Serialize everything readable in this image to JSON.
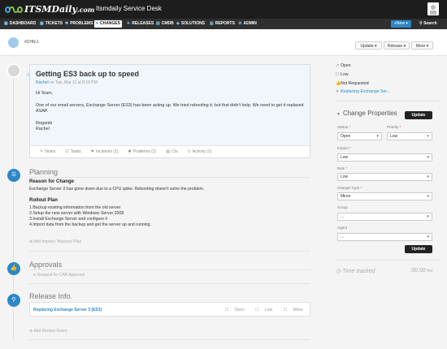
{
  "header": {
    "logo_text": "ITSMDaily",
    "logo_suffix": ".com",
    "app_title": "Itsmdaily Service Desk"
  },
  "nav": {
    "items": [
      {
        "label": "DASHBOARD",
        "icon": "dashboard-icon"
      },
      {
        "label": "TICKETS",
        "icon": "ticket-icon"
      },
      {
        "label": "PROBLEMS",
        "icon": "problem-icon"
      },
      {
        "label": "CHANGES",
        "icon": "change-icon",
        "active": true
      },
      {
        "label": "RELEASES",
        "icon": "release-icon"
      },
      {
        "label": "CMDB",
        "icon": "cmdb-icon"
      },
      {
        "label": "SOLUTIONS",
        "icon": "solutions-icon"
      },
      {
        "label": "REPORTS",
        "icon": "reports-icon"
      },
      {
        "label": "ADMIN",
        "icon": "admin-icon"
      }
    ],
    "new_label": "New",
    "search_label": "Search"
  },
  "record": {
    "id": "#CHN-1",
    "update_label": "Update",
    "release_label": "Release",
    "more_label": "More"
  },
  "note": {
    "title": "Getting ES3 back up to speed",
    "author": "Rachel",
    "date": "on Tue, Mar 11 at 8:16 PM",
    "greeting": "Hi Team,",
    "body": "One of our email servers, Exchange Server (ES3) has been acting up. We tried rebooting it, but that didn't help. We need to get it replaced ASAP.",
    "signoff": "Regards",
    "signature": "Rachel",
    "tabs": [
      "Notes",
      "Tasks",
      "Incidents (1)",
      "Problems (1)",
      "CIs",
      "Activity (1)"
    ]
  },
  "planning": {
    "title": "Planning",
    "reason_heading": "Reason for Change",
    "reason_text": "Exchange Server 3 has gone down due to a CPU spike. Rebooting doesn't solve the problem.",
    "rollout_heading": "Rollout Plan",
    "rollout_steps": [
      "1.Backup existing information from the old server",
      "2.Setup the new server with Windows Server 2008",
      "3.Install Exchange Server and configure it",
      "4.Import data from the backup and get the server up and running."
    ],
    "add_link": "Add Impact / Backout Plan"
  },
  "approvals": {
    "title": "Approvals",
    "request_link": "Request for CAB Approval"
  },
  "release_info": {
    "title": "Release Info.",
    "release_name": "Replacing Exchange Server 3 (ES3)",
    "status": "Open",
    "priority": "Low",
    "type": "Minor",
    "add_link": "Add Review Notes"
  },
  "sidebar": {
    "status": "Open",
    "priority": "Low",
    "approval": "Not Requested",
    "release_link": "Replacing Exchange Ser...",
    "change_properties_title": "Change Properties",
    "update_label": "Update",
    "status_label": "Status",
    "status_value": "Open",
    "priority_label": "Priority",
    "priority_value": "Low",
    "impact_label": "Impact",
    "impact_value": "Low",
    "risk_label": "Risk",
    "risk_value": "Low",
    "change_type_label": "Change Type",
    "change_type_value": "Minor",
    "group_label": "Group",
    "group_value": "...",
    "agent_label": "Agent",
    "agent_value": "...",
    "time_tracked_label": "Time tracked",
    "time_tracked_value": "00:00",
    "time_tracked_unit": "hrs"
  },
  "colors": {
    "accent": "#2b88c8",
    "header_bg": "#1d1d1d",
    "nav_bg": "#2f2f2f"
  }
}
